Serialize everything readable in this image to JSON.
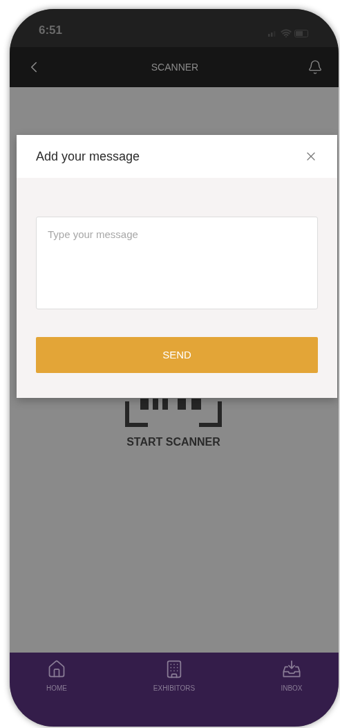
{
  "status_bar": {
    "time": "6:51"
  },
  "header": {
    "title": "SCANNER"
  },
  "scanner": {
    "label": "START SCANNER"
  },
  "dialog": {
    "title": "Add your message",
    "message": {
      "placeholder": "Type your message"
    },
    "send_button": "SEND"
  },
  "tab_bar": [
    {
      "label": "HOME",
      "kind": "home"
    },
    {
      "label": "EXHIBITORS",
      "kind": "exhibitors"
    },
    {
      "label": "INBOX",
      "kind": "inbox"
    }
  ]
}
